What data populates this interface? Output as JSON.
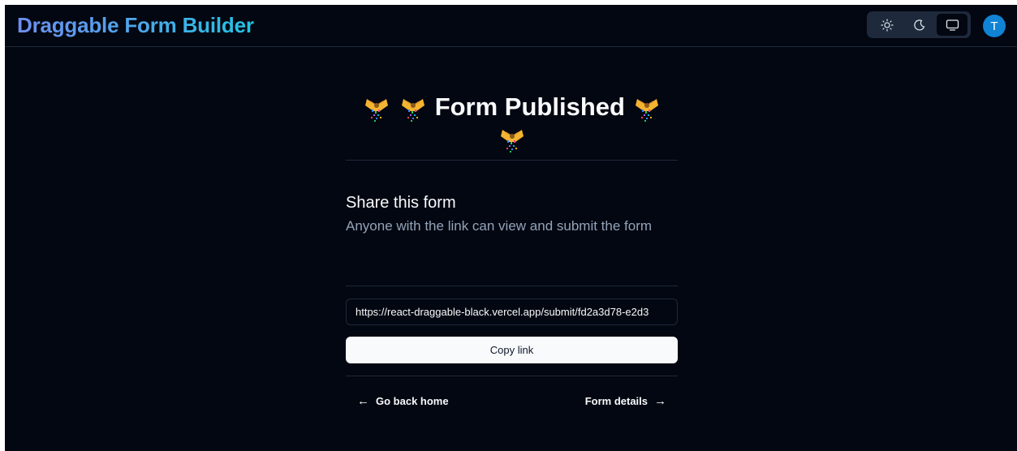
{
  "header": {
    "title": "Draggable Form Builder",
    "theme_toggle": {
      "options": [
        {
          "name": "light",
          "icon": "sun-icon"
        },
        {
          "name": "dark",
          "icon": "moon-icon"
        },
        {
          "name": "system",
          "icon": "monitor-icon"
        }
      ],
      "selected": "system"
    },
    "avatar_initial": "T"
  },
  "main": {
    "title": "Form Published",
    "title_emoji": "party-popper",
    "share_heading": "Share this form",
    "share_description": "Anyone with the link can view and submit the form",
    "share_link": "https://react-draggable-black.vercel.app/submit/fd2a3d78-e2d3",
    "copy_label": "Copy link",
    "back_label": "Go back home",
    "details_label": "Form details"
  },
  "colors": {
    "background": "#030711",
    "border": "#1e293b",
    "muted_text": "#94a3b8",
    "avatar": "#1083d4",
    "brand_gradient_start": "#6d8ff0",
    "brand_gradient_end": "#22c3e6"
  }
}
